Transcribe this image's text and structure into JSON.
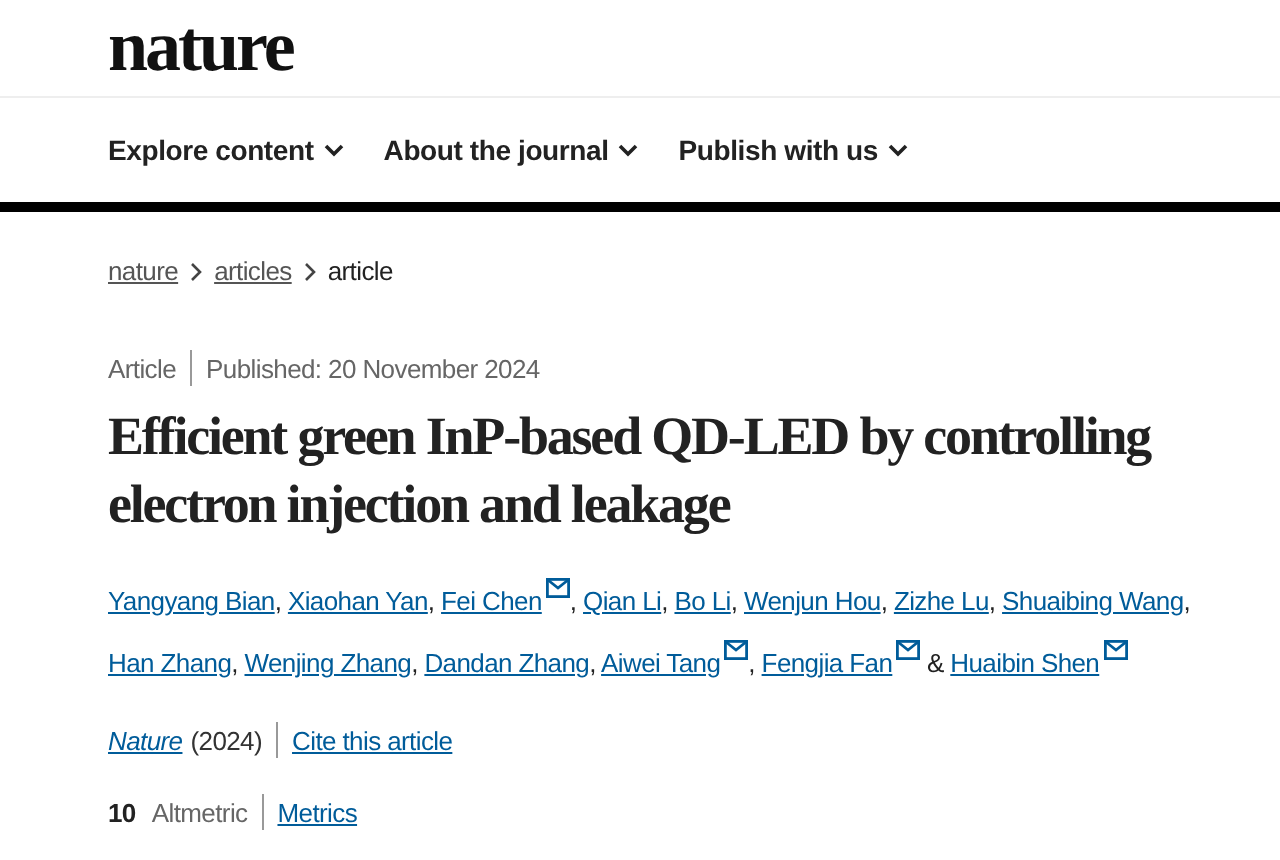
{
  "logo": "nature",
  "nav": [
    {
      "label": "Explore content"
    },
    {
      "label": "About the journal"
    },
    {
      "label": "Publish with us"
    }
  ],
  "breadcrumbs": [
    {
      "label": "nature",
      "link": true
    },
    {
      "label": "articles",
      "link": true
    },
    {
      "label": "article",
      "link": false
    }
  ],
  "article_type": "Article",
  "published": "Published: 20 November 2024",
  "title": "Efficient green InP-based QD-LED by controlling electron injection and leakage",
  "authors": [
    {
      "name": "Yangyang Bian",
      "corresponding": false,
      "separator": ","
    },
    {
      "name": "Xiaohan Yan",
      "corresponding": false,
      "separator": ","
    },
    {
      "name": "Fei Chen",
      "corresponding": true,
      "separator": ","
    },
    {
      "name": "Qian Li",
      "corresponding": false,
      "separator": ","
    },
    {
      "name": "Bo Li",
      "corresponding": false,
      "separator": ","
    },
    {
      "name": "Wenjun Hou",
      "corresponding": false,
      "separator": ","
    },
    {
      "name": "Zizhe Lu",
      "corresponding": false,
      "separator": ","
    },
    {
      "name": "Shuaibing Wang",
      "corresponding": false,
      "separator": ","
    },
    {
      "name": "Han Zhang",
      "corresponding": false,
      "separator": ","
    },
    {
      "name": "Wenjing Zhang",
      "corresponding": false,
      "separator": ","
    },
    {
      "name": "Dandan Zhang",
      "corresponding": false,
      "separator": ","
    },
    {
      "name": "Aiwei Tang",
      "corresponding": true,
      "separator": ","
    },
    {
      "name": "Fengjia Fan",
      "corresponding": true,
      "separator": "&"
    },
    {
      "name": "Huaibin Shen",
      "corresponding": true
    }
  ],
  "journal": "Nature",
  "year": "(2024)",
  "cite": "Cite this article",
  "altmetric_score": "10",
  "altmetric_label": "Altmetric",
  "metrics": "Metrics"
}
